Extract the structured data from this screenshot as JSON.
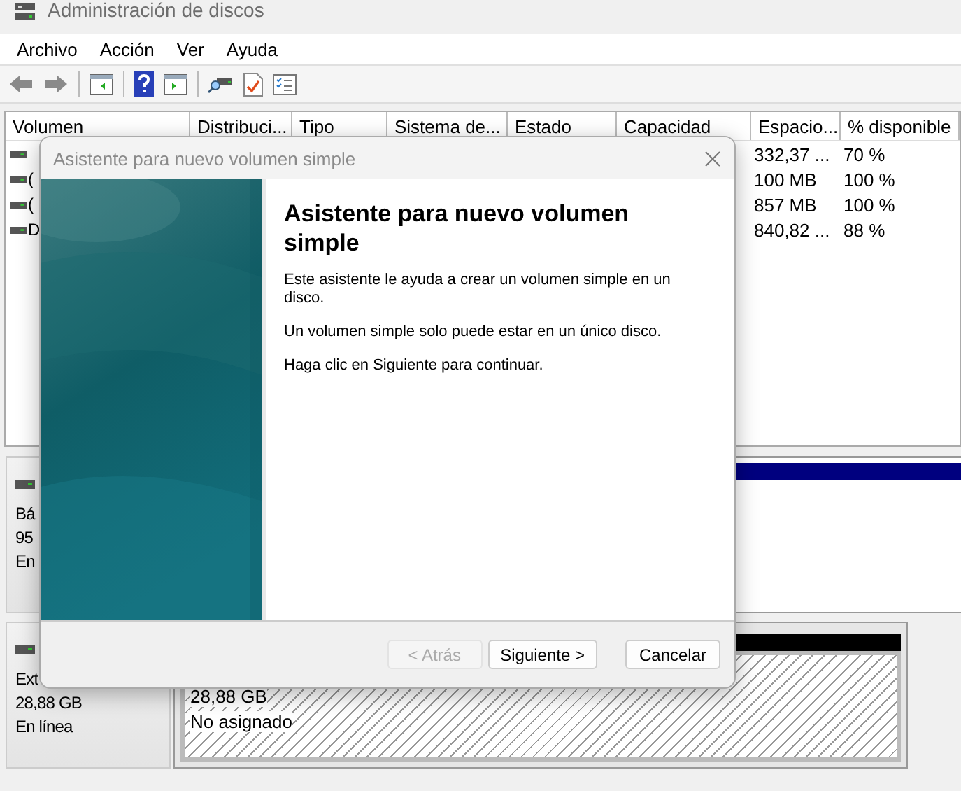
{
  "window": {
    "title": "Administración de discos"
  },
  "menu": [
    "Archivo",
    "Acción",
    "Ver",
    "Ayuda"
  ],
  "table": {
    "columns": [
      "Volumen",
      "Distribuci...",
      "Tipo",
      "Sistema de...",
      "Estado",
      "Capacidad",
      "Espacio...",
      "% disponible"
    ],
    "rows": [
      {
        "free": "332,37 ...",
        "percent": "70 %"
      },
      {
        "volume": "(",
        "free": "100 MB",
        "percent": "100 %"
      },
      {
        "volume": "(",
        "free": "857 MB",
        "percent": "100 %"
      },
      {
        "volume": "D",
        "free": "840,82 ...",
        "percent": "88 %"
      }
    ]
  },
  "disks": [
    {
      "lines": [
        "Bá",
        "95",
        "En"
      ],
      "partition": {
        "kind": "primary"
      }
    },
    {
      "lines": [
        "Ext",
        "28,88 GB",
        "En línea"
      ],
      "partition": {
        "kind": "unallocated",
        "size": "28,88 GB",
        "status": "No asignado"
      }
    }
  ],
  "dialog": {
    "title": "Asistente para nuevo volumen simple",
    "heading": "Asistente para nuevo volumen simple",
    "paragraphs": [
      "Este asistente le ayuda a crear un volumen simple en un disco.",
      "Un volumen simple solo puede estar en un único disco.",
      "Haga clic en Siguiente para continuar."
    ],
    "buttons": [
      {
        "label": "< Atrás",
        "disabled": true
      },
      {
        "label": "Siguiente >",
        "disabled": false
      },
      {
        "label": "Cancelar",
        "disabled": false
      }
    ]
  }
}
